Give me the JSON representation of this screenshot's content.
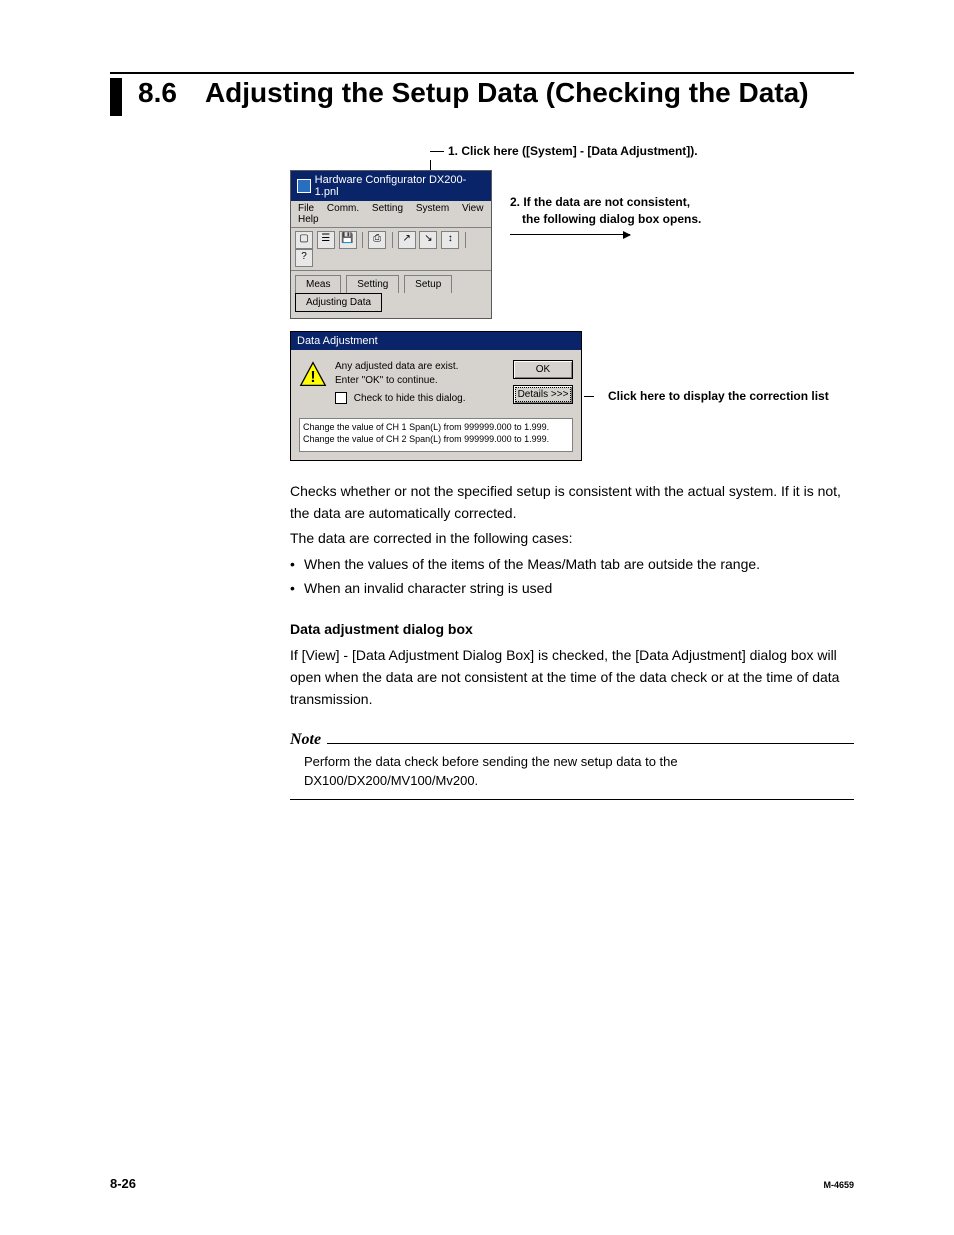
{
  "heading": {
    "number": "8.6",
    "title": "Adjusting the Setup Data (Checking the Data)"
  },
  "callouts": {
    "step1": "1. Click here ([System] - [Data Adjustment]).",
    "step2a": "2. If the data are not consistent,",
    "step2b": "the following dialog box opens.",
    "details": "Click here to display the correction list"
  },
  "app_window": {
    "title": "Hardware Configurator DX200-1.pnl",
    "menus": [
      "File",
      "Comm.",
      "Setting",
      "System",
      "View",
      "Help"
    ],
    "toolbar_icons": [
      "new-icon",
      "open-icon",
      "save-icon",
      "print-icon",
      "send-icon",
      "receive-icon",
      "adjust-icon",
      "help-icon"
    ],
    "tabs": [
      "Meas",
      "Setting",
      "Setup",
      "Adjusting Data"
    ],
    "active_tab_index": 3
  },
  "dialog": {
    "title": "Data Adjustment",
    "line1": "Any adjusted data are exist.",
    "line2": "Enter \"OK\" to continue.",
    "check_label": "Check to hide this dialog.",
    "ok": "OK",
    "details": "Details >>>",
    "list": [
      "Change the value of CH 1 Span(L) from 999999.000 to 1.999.",
      "Change the value of CH 2 Span(L) from 999999.000 to 1.999."
    ]
  },
  "body": {
    "p1": "Checks whether or not the specified setup is consistent with the actual system.  If it is not, the data are automatically corrected.",
    "p2": "The data are corrected in the following cases:",
    "b1": "When the values of the items of the Meas/Math tab are outside the range.",
    "b2": "When an invalid character string is used",
    "sub": "Data adjustment dialog box",
    "p3": "If [View] - [Data Adjustment Dialog Box] is checked, the [Data Adjustment] dialog box will open when the data are not consistent at the time of the data check or at the time of data transmission."
  },
  "note": {
    "label": "Note",
    "text": "Perform the data check before sending the new setup data to the DX100/DX200/MV100/Mv200."
  },
  "footer": {
    "page": "8-26",
    "doc": "M-4659"
  }
}
